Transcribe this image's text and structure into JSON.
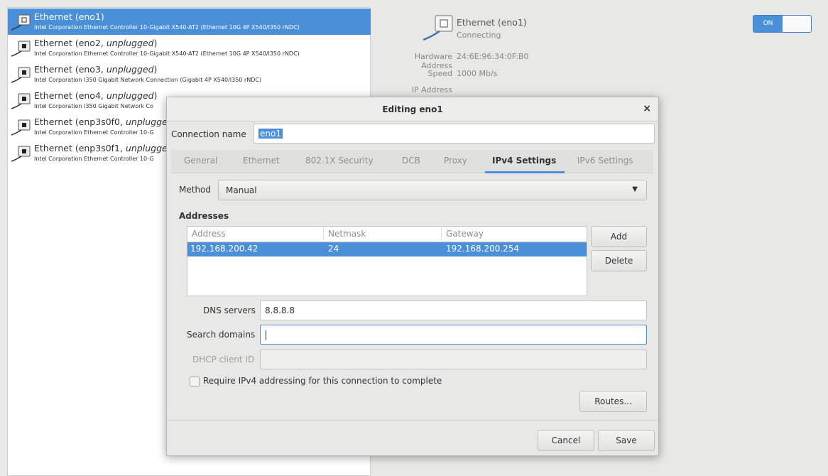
{
  "sidebar": {
    "items": [
      {
        "name": "Ethernet (eno1)",
        "state": "",
        "desc": "Intel Corporation Ethernet Controller 10-Gigabit X540-AT2 (Ethernet 10G 4P X540/I350 rNDC)"
      },
      {
        "name": "Ethernet (eno2, ",
        "state": "unplugged",
        "close": ")",
        "desc": "Intel Corporation Ethernet Controller 10-Gigabit X540-AT2 (Ethernet 10G 4P X540/I350 rNDC)"
      },
      {
        "name": "Ethernet (eno3, ",
        "state": "unplugged",
        "close": ")",
        "desc": "Intel Corporation I350 Gigabit Network Connection (Gigabit 4P X540/I350 rNDC)"
      },
      {
        "name": "Ethernet (eno4, ",
        "state": "unplugged",
        "close": ")",
        "desc": "Intel Corporation I350 Gigabit Network Co"
      },
      {
        "name": "Ethernet (enp3s0f0, ",
        "state": "unplugge",
        "close": "",
        "desc": "Intel Corporation Ethernet Controller 10-G"
      },
      {
        "name": "Ethernet (enp3s0f1, ",
        "state": "unplugge",
        "close": "",
        "desc": "Intel Corporation Ethernet Controller 10-G"
      }
    ]
  },
  "detail": {
    "title": "Ethernet (eno1)",
    "status": "Connecting",
    "hw_label": "Hardware Address",
    "hw_value": "24:6E:96:34:0F:B0",
    "speed_label": "Speed",
    "speed_value": "1000 Mb/s",
    "ip_label": "IP Address",
    "toggle_label": "ON"
  },
  "dialog": {
    "title": "Editing eno1",
    "close": "×",
    "conn_name_label": "Connection name",
    "conn_name_value": "eno1",
    "tabs": [
      "General",
      "Ethernet",
      "802.1X Security",
      "DCB",
      "Proxy",
      "IPv4 Settings",
      "IPv6 Settings"
    ],
    "active_tab": "IPv4 Settings",
    "method_label": "Method",
    "method_value": "Manual",
    "addresses_label": "Addresses",
    "columns": [
      "Address",
      "Netmask",
      "Gateway"
    ],
    "rows": [
      [
        "192.168.200.42",
        "24",
        "192.168.200.254"
      ]
    ],
    "add_label": "Add",
    "delete_label": "Delete",
    "dns_label": "DNS servers",
    "dns_value": "8.8.8.8",
    "search_label": "Search domains",
    "search_value": "",
    "dhcp_label": "DHCP client ID",
    "dhcp_value": "",
    "require_label": "Require IPv4 addressing for this connection to complete",
    "routes_label": "Routes...",
    "cancel_label": "Cancel",
    "save_label": "Save"
  },
  "colors": {
    "accent": "#4a90d9",
    "window_bg": "#e8e8e7"
  }
}
